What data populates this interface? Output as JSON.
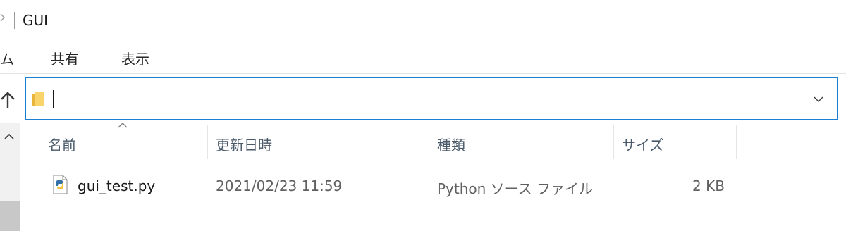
{
  "window": {
    "title": "GUI"
  },
  "ribbon": {
    "tabs": [
      {
        "label": "ム"
      },
      {
        "label": "共有"
      },
      {
        "label": "表示"
      }
    ]
  },
  "address": {
    "value": ""
  },
  "columns": [
    {
      "label": "名前"
    },
    {
      "label": "更新日時"
    },
    {
      "label": "種類"
    },
    {
      "label": "サイズ"
    }
  ],
  "files": [
    {
      "name": "gui_test.py",
      "modified": "2021/02/23 11:59",
      "type": "Python ソース ファイル",
      "size": "2 KB",
      "icon": "python-file-icon"
    }
  ],
  "colors": {
    "accent": "#1a7fd0",
    "folder": "#f5c84c",
    "header_text": "#4a5a6a"
  }
}
